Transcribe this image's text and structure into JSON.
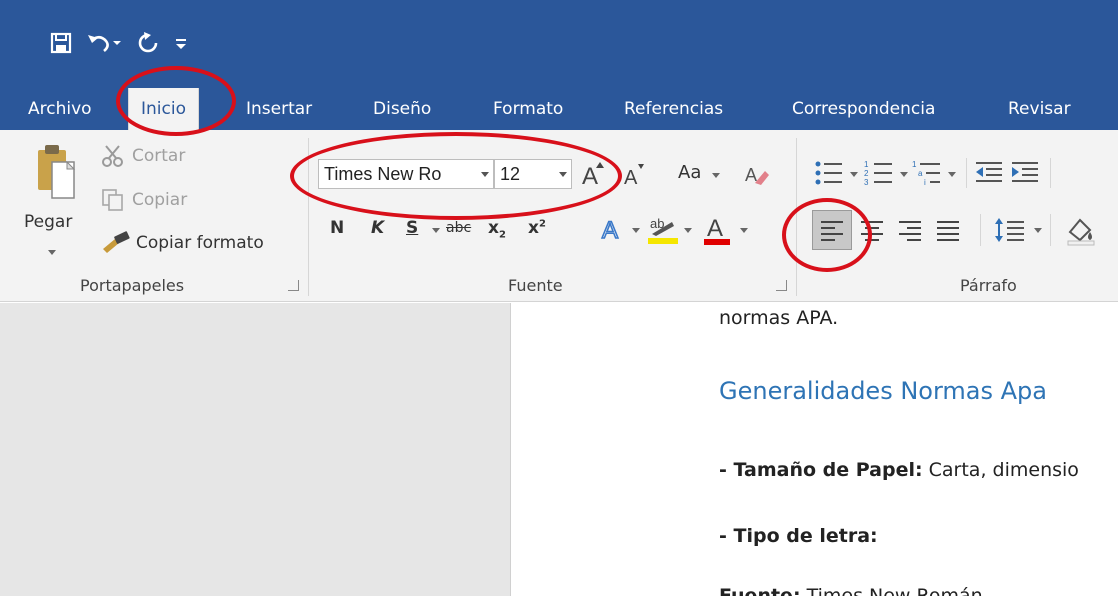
{
  "colors": {
    "word_blue": "#2b579a",
    "ribbon_bg": "#f3f3f3",
    "annotation_red": "#d8101a",
    "heading_blue": "#2e74b5"
  },
  "qat": {
    "icons": [
      "save-icon",
      "undo-icon",
      "redo-icon",
      "customize-qat-icon"
    ]
  },
  "tabs": [
    "Archivo",
    "Inicio",
    "Insertar",
    "Diseño",
    "Formato",
    "Referencias",
    "Correspondencia",
    "Revisar"
  ],
  "clipboard": {
    "paste_label": "Pegar",
    "cut_label": "Cortar",
    "copy_label": "Copiar",
    "format_painter_label": "Copiar formato",
    "group_label": "Portapapeles"
  },
  "font": {
    "font_name": "Times New Ro",
    "font_size": "12",
    "change_case_label": "Aa",
    "bold_label": "N",
    "italic_label": "K",
    "underline_label": "S",
    "strikethrough_label": "abc",
    "subscript_label": "x",
    "superscript_label": "x",
    "group_label": "Fuente"
  },
  "paragraph": {
    "group_label": "Párrafo"
  },
  "document": {
    "line1": "normas APA.",
    "heading": "Generalidades Normas Apa",
    "line2_bold": "- Tamaño de Papel:",
    "line2_rest": " Carta, dimensio",
    "line3_bold": "- Tipo de letra:",
    "line4_bold": "Fuente:",
    "line4_rest": " Times New Román"
  }
}
